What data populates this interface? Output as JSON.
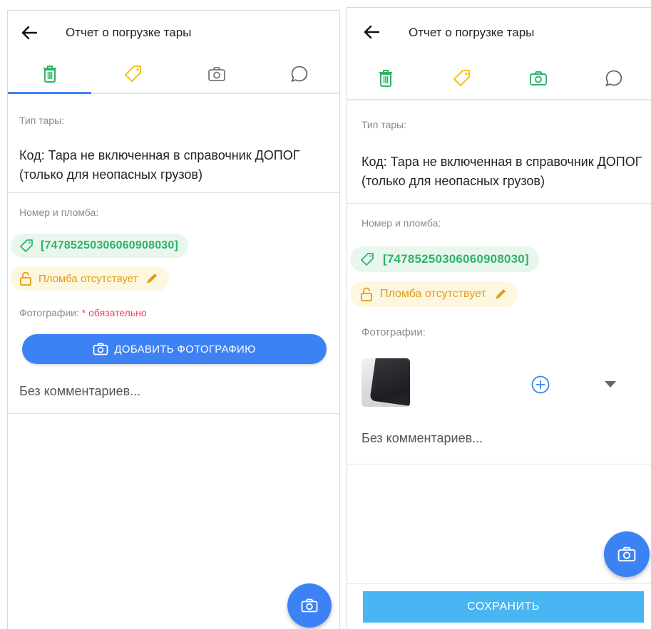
{
  "screen_left": {
    "title": "Отчет о погрузке тары",
    "tabs": [
      {
        "name": "trash-icon",
        "active": true
      },
      {
        "name": "tag-icon",
        "active": false
      },
      {
        "name": "camera-icon",
        "active": false
      },
      {
        "name": "comment-icon",
        "active": false
      }
    ],
    "container_type_label": "Тип тары:",
    "container_type_value": "Код: Тара не включенная в справочник ДОПОГ (только для неопасных грузов)",
    "number_seal_label": "Номер и пломба:",
    "number_chip": "[74785250306060908030]",
    "seal_chip": "Пломба отсутствует",
    "photos_label": "Фотографии:",
    "photos_required": "* обязательно",
    "add_photo_button": "ДОБАВИТЬ ФОТОГРАФИЮ",
    "comment_placeholder": "Без комментариев..."
  },
  "screen_right": {
    "title": "Отчет о погрузке тары",
    "tabs": [
      {
        "name": "trash-icon"
      },
      {
        "name": "tag-icon"
      },
      {
        "name": "camera-icon"
      },
      {
        "name": "comment-icon"
      }
    ],
    "container_type_label": "Тип тары:",
    "container_type_value": "Код: Тара не включенная в справочник ДОПОГ (только для неопасных грузов)",
    "number_seal_label": "Номер и пломба:",
    "number_chip": "[74785250306060908030]",
    "seal_chip": "Пломба отсутствует",
    "photos_label": "Фотографии:",
    "comment_placeholder": "Без комментариев...",
    "save_button": "СОХРАНИТЬ"
  },
  "colors": {
    "accent_blue": "#3d82f5",
    "save_blue": "#47b6f2",
    "green": "#2fb368",
    "yellow": "#e09b1a",
    "required_red": "#f0435a"
  }
}
